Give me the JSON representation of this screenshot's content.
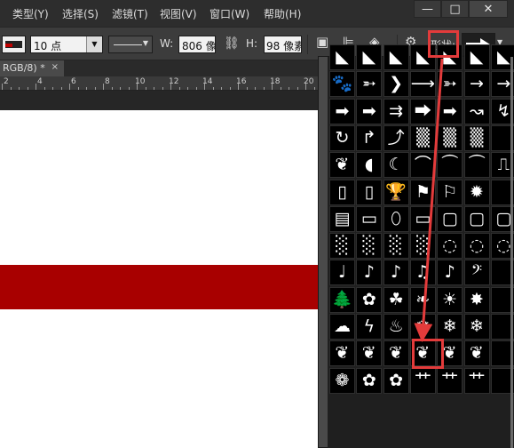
{
  "menubar": {
    "items": [
      "类型(Y)",
      "选择(S)",
      "滤镜(T)",
      "视图(V)",
      "窗口(W)",
      "帮助(H)"
    ],
    "window_buttons": [
      "—",
      "□",
      "✕"
    ]
  },
  "options": {
    "stroke_size": "10 点",
    "width_label": "W:",
    "width_value": "806 像",
    "height_label": "H:",
    "height_value": "98 像素",
    "shape_label": "形状:"
  },
  "document": {
    "tab_label": "RGB/8) *",
    "tab_close": "×",
    "ruler_numbers": [
      "2",
      "4",
      "6",
      "8",
      "10",
      "12",
      "14",
      "16",
      "18",
      "20"
    ]
  },
  "shape_picker": {
    "rows": [
      [
        "fold-corner",
        "fold-corner",
        "fold-corner",
        "fold-corner",
        "fold-corner",
        "fold-corner",
        "fold-corner"
      ],
      [
        "paw-print",
        "dart-arrow",
        "chevron-arrow",
        "line-arrow",
        "feather-arrow",
        "thin-arrow",
        "thin-arrow"
      ],
      [
        "bold-arrow",
        "bold-arrow",
        "double-arrow",
        "block-arrow",
        "bold-arrow",
        "wave-arrow",
        "zigzag-arrow"
      ],
      [
        "curved-arrow",
        "turn-arrow",
        "bend-arrow",
        "texture",
        "texture",
        "texture",
        "blank"
      ],
      [
        "ornament",
        "bubble",
        "crescent",
        "swoosh",
        "banner",
        "banner",
        "ribbon"
      ],
      [
        "scroll",
        "scroll",
        "trophy",
        "flag",
        "wavy-flag",
        "seal",
        "blank"
      ],
      [
        "film-frame",
        "frame",
        "oval-frame",
        "frame",
        "ornate-frame",
        "ornate-frame",
        "ornate-frame"
      ],
      [
        "grunge-border",
        "grunge-border",
        "grunge-border",
        "grunge-border",
        "grunge-circle",
        "grunge-circle",
        "grunge-circle"
      ],
      [
        "quarter-note",
        "eighth-note",
        "eighth-note",
        "beamed-notes",
        "eighth-note",
        "bass-clef",
        "blank"
      ],
      [
        "tree",
        "flower",
        "clover",
        "butterfly",
        "sunburst",
        "star-burst",
        "blank"
      ],
      [
        "cloud",
        "lightning",
        "fire",
        "snowflake",
        "snowflake",
        "snowflake",
        "blank"
      ],
      [
        "leaf",
        "leaf",
        "leaf",
        "leaf",
        "leaf",
        "leaf",
        "blank"
      ],
      [
        "daisy",
        "flower",
        "flower",
        "grass",
        "grass",
        "grass",
        "blank"
      ]
    ]
  },
  "highlight_color": "#e33b3b"
}
